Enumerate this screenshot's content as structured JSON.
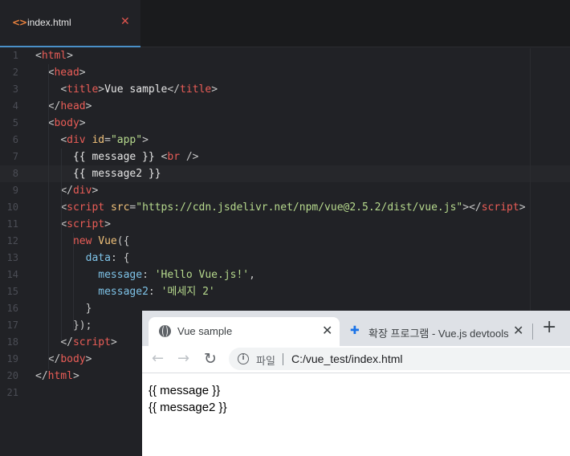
{
  "editor": {
    "tab": {
      "icon": "code-icon",
      "label": "index.html",
      "close_icon": "close-icon"
    },
    "line_numbers": [
      "1",
      "2",
      "3",
      "4",
      "5",
      "6",
      "7",
      "8",
      "9",
      "10",
      "11",
      "12",
      "13",
      "14",
      "15",
      "16",
      "17",
      "18",
      "19",
      "20",
      "21"
    ],
    "current_line": 8,
    "lines": [
      [
        [
          "br",
          "<"
        ],
        [
          "tag",
          "html"
        ],
        [
          "br",
          ">"
        ]
      ],
      [
        [
          "txt",
          "  "
        ],
        [
          "br",
          "<"
        ],
        [
          "tag",
          "head"
        ],
        [
          "br",
          ">"
        ]
      ],
      [
        [
          "txt",
          "    "
        ],
        [
          "br",
          "<"
        ],
        [
          "tag",
          "title"
        ],
        [
          "br",
          ">"
        ],
        [
          "txt",
          "Vue sample"
        ],
        [
          "br",
          "</"
        ],
        [
          "tag",
          "title"
        ],
        [
          "br",
          ">"
        ]
      ],
      [
        [
          "txt",
          "  "
        ],
        [
          "br",
          "</"
        ],
        [
          "tag",
          "head"
        ],
        [
          "br",
          ">"
        ]
      ],
      [
        [
          "txt",
          "  "
        ],
        [
          "br",
          "<"
        ],
        [
          "tag",
          "body"
        ],
        [
          "br",
          ">"
        ]
      ],
      [
        [
          "txt",
          "    "
        ],
        [
          "br",
          "<"
        ],
        [
          "tag",
          "div"
        ],
        [
          "txt",
          " "
        ],
        [
          "attr",
          "id"
        ],
        [
          "br",
          "="
        ],
        [
          "str",
          "\"app\""
        ],
        [
          "br",
          ">"
        ]
      ],
      [
        [
          "txt",
          "      {{ message }} "
        ],
        [
          "br",
          "<"
        ],
        [
          "tag",
          "br"
        ],
        [
          "txt",
          " "
        ],
        [
          "br",
          "/>"
        ]
      ],
      [
        [
          "txt",
          "      {{ message2 }}"
        ]
      ],
      [
        [
          "txt",
          "    "
        ],
        [
          "br",
          "</"
        ],
        [
          "tag",
          "div"
        ],
        [
          "br",
          ">"
        ]
      ],
      [
        [
          "txt",
          "    "
        ],
        [
          "br",
          "<"
        ],
        [
          "tag",
          "script"
        ],
        [
          "txt",
          " "
        ],
        [
          "attr",
          "src"
        ],
        [
          "br",
          "="
        ],
        [
          "str",
          "\"https://cdn.jsdelivr.net/npm/vue@2.5.2/dist/vue.js\""
        ],
        [
          "br",
          "></"
        ],
        [
          "tag",
          "script"
        ],
        [
          "br",
          ">"
        ]
      ],
      [
        [
          "txt",
          "    "
        ],
        [
          "br",
          "<"
        ],
        [
          "tag",
          "script"
        ],
        [
          "br",
          ">"
        ]
      ],
      [
        [
          "txt",
          "      "
        ],
        [
          "kw",
          "new"
        ],
        [
          "txt",
          " "
        ],
        [
          "cls",
          "Vue"
        ],
        [
          "br",
          "({"
        ]
      ],
      [
        [
          "txt",
          "        "
        ],
        [
          "prop",
          "data"
        ],
        [
          "br",
          ": {"
        ]
      ],
      [
        [
          "txt",
          "          "
        ],
        [
          "prop",
          "message"
        ],
        [
          "br",
          ": "
        ],
        [
          "str",
          "'Hello Vue.js!'"
        ],
        [
          "br",
          ","
        ]
      ],
      [
        [
          "txt",
          "          "
        ],
        [
          "prop",
          "message2"
        ],
        [
          "br",
          ": "
        ],
        [
          "str",
          "'메세지 2'"
        ]
      ],
      [
        [
          "txt",
          "        "
        ],
        [
          "br",
          "}"
        ]
      ],
      [
        [
          "txt",
          "      "
        ],
        [
          "br",
          "});"
        ]
      ],
      [
        [
          "txt",
          "    "
        ],
        [
          "br",
          "</"
        ],
        [
          "tag",
          "script"
        ],
        [
          "br",
          ">"
        ]
      ],
      [
        [
          "txt",
          "  "
        ],
        [
          "br",
          "</"
        ],
        [
          "tag",
          "body"
        ],
        [
          "br",
          ">"
        ]
      ],
      [
        [
          "br",
          "</"
        ],
        [
          "tag",
          "html"
        ],
        [
          "br",
          ">"
        ]
      ],
      []
    ]
  },
  "browser": {
    "tabs": [
      {
        "icon": "globe-icon",
        "label": "Vue sample",
        "close": "✕",
        "active": true
      },
      {
        "icon": "puzzle-icon",
        "label": "확장 프로그램 - Vue.js devtools",
        "close": "✕",
        "active": false
      }
    ],
    "new_tab": "+",
    "nav": {
      "back": "←",
      "forward": "→",
      "reload": "↻"
    },
    "address": {
      "scheme_label": "파일",
      "url": "C:/vue_test/index.html"
    },
    "content": [
      "{{ message }}",
      "{{ message2 }}"
    ]
  }
}
